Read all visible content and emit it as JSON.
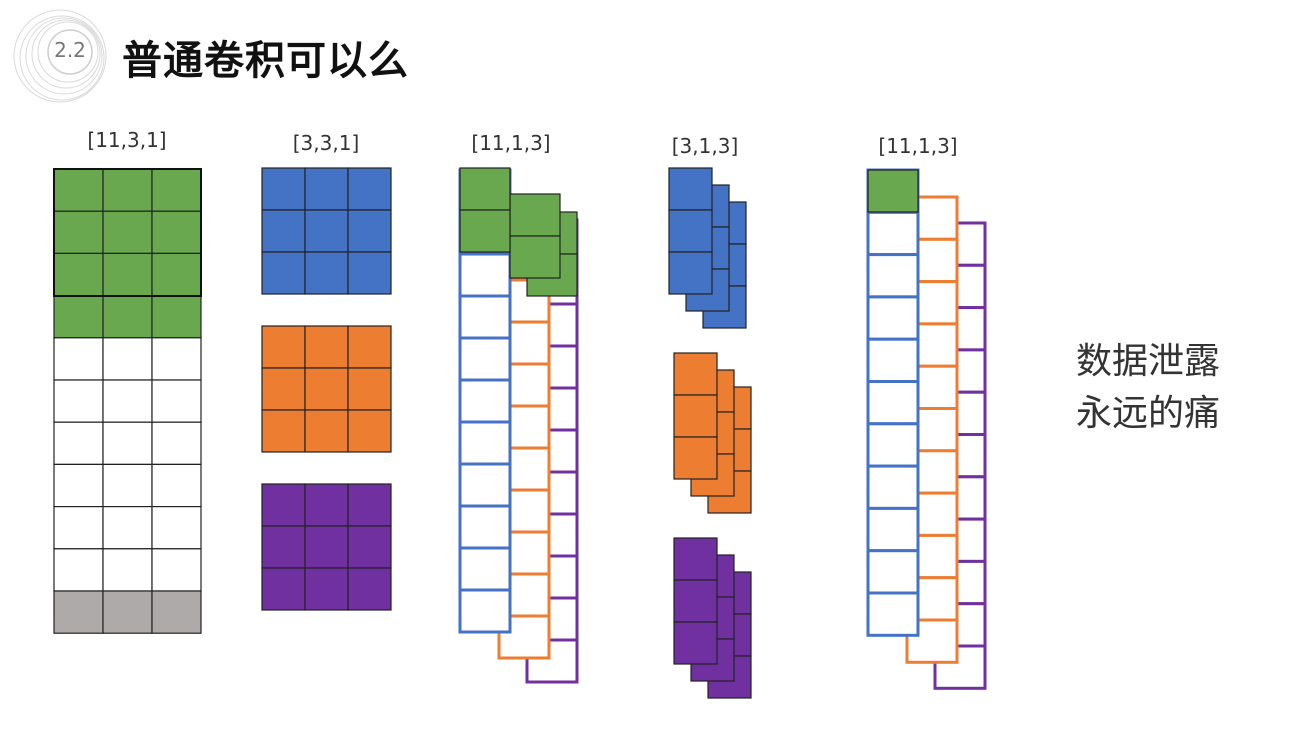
{
  "header": {
    "section_number": "2.2",
    "title": "普通卷积可以么"
  },
  "labels": {
    "input_shape": "[11,3,1]",
    "kernel_shape": "[3,3,1]",
    "input_shape_transposed": "[11,1,3]",
    "kernel_shape_transposed": "[3,1,3]",
    "input_shape_transposed_2": "[11,1,3]"
  },
  "side_note": {
    "line1": "数据泄露",
    "line2": "永远的痛"
  },
  "colors": {
    "green": "#6aa84f",
    "blue": "#4472c4",
    "orange": "#ed7d31",
    "purple": "#7030a0",
    "gray": "#aeaaaa"
  },
  "icons": {
    "badge": "swirl-circle-badge"
  }
}
